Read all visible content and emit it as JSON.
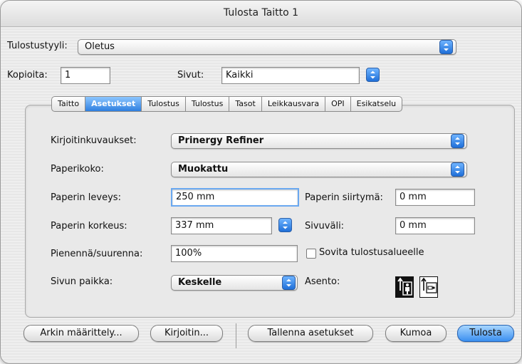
{
  "window": {
    "title": "Tulosta Taitto 1"
  },
  "style": {
    "label": "Tulostustyyli:",
    "value": "Oletus"
  },
  "copies": {
    "label": "Kopioita:",
    "value": "1"
  },
  "pages": {
    "label": "Sivut:",
    "value": "Kaikki"
  },
  "tabs": [
    {
      "label": "Taitto",
      "active": false
    },
    {
      "label": "Asetukset",
      "active": true
    },
    {
      "label": "Tulostus",
      "active": false
    },
    {
      "label": "Tulostus",
      "active": false
    },
    {
      "label": "Tasot",
      "active": false
    },
    {
      "label": "Leikkausvara",
      "active": false
    },
    {
      "label": "OPI",
      "active": false
    },
    {
      "label": "Esikatselu",
      "active": false
    }
  ],
  "settings": {
    "printer_desc_label": "Kirjoitinkuvaukset:",
    "printer_desc_value": "Prinergy Refiner",
    "paper_size_label": "Paperikoko:",
    "paper_size_value": "Muokattu",
    "paper_width_label": "Paperin leveys:",
    "paper_width_value": "250 mm",
    "paper_offset_label": "Paperin siirtymä:",
    "paper_offset_value": "0 mm",
    "paper_height_label": "Paperin korkeus:",
    "paper_height_value": "337 mm",
    "page_gap_label": "Sivuväli:",
    "page_gap_value": "0 mm",
    "scale_label": "Pienennä/suurenna:",
    "scale_value": "100%",
    "fit_label": "Sovita tulostusalueelle",
    "fit_checked": false,
    "page_position_label": "Sivun paikka:",
    "page_position_value": "Keskelle",
    "orientation_label": "Asento:",
    "orientation_selected": "portrait"
  },
  "buttons": {
    "page_setup": "Arkin määrittely...",
    "printer": "Kirjoitin...",
    "save_settings": "Tallenna asetukset",
    "cancel": "Kumoa",
    "print": "Tulosta"
  },
  "colors": {
    "accent": "#3b8ff0",
    "active_tab": "#2f7fe0"
  }
}
